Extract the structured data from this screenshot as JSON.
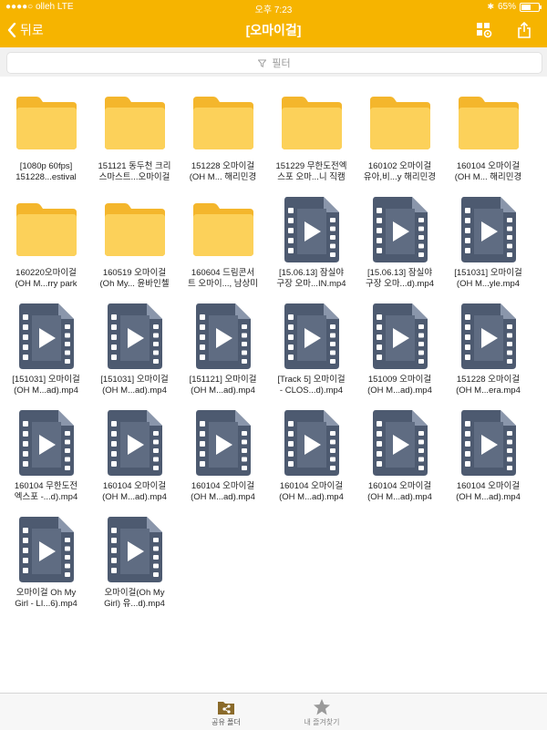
{
  "status_bar": {
    "carrier": "●●●●○ olleh  LTE",
    "time": "오후 7:23",
    "battery": "65%",
    "battery_level": 0.65
  },
  "nav": {
    "back_label": "뒤로",
    "title": "[오마이걸]"
  },
  "filter": {
    "placeholder": "필터"
  },
  "items": [
    {
      "type": "folder",
      "label": "[1080p 60fps]\n151228...estival"
    },
    {
      "type": "folder",
      "label": "151121 동두천 크리\n스마스트...오마이걸"
    },
    {
      "type": "folder",
      "label": "151228 오마이걸\n(OH M... 해리민경"
    },
    {
      "type": "folder",
      "label": "151229 무한도전엑\n스포 오마...니 직캠"
    },
    {
      "type": "folder",
      "label": "160102 오마이걸\n유아,비...y 해리민경"
    },
    {
      "type": "folder",
      "label": "160104 오마이걸\n(OH M... 해리민경"
    },
    {
      "type": "folder",
      "label": "160220오마이걸\n(OH M...rry park"
    },
    {
      "type": "folder",
      "label": "160519 오마이걸\n(Oh My... 윤바인첼"
    },
    {
      "type": "folder",
      "label": "160604 드림콘서\n트 오마이..., 남상미"
    },
    {
      "type": "video",
      "label": "[15.06.13] 잠실야\n구장 오마...IN.mp4"
    },
    {
      "type": "video",
      "label": "[15.06.13] 잠실야\n구장 오마...d).mp4"
    },
    {
      "type": "video",
      "label": "[151031] 오마이걸\n(OH M...yle.mp4"
    },
    {
      "type": "video",
      "label": "[151031] 오마이걸\n(OH M...ad).mp4"
    },
    {
      "type": "video",
      "label": "[151031] 오마이걸\n(OH M...ad).mp4"
    },
    {
      "type": "video",
      "label": "[151121] 오마이걸\n(OH M...ad).mp4"
    },
    {
      "type": "video",
      "label": "[Track 5] 오마이걸\n- CLOS...d).mp4"
    },
    {
      "type": "video",
      "label": "151009 오마이걸\n(OH M...ad).mp4"
    },
    {
      "type": "video",
      "label": "151228 오마이걸\n(OH M...era.mp4"
    },
    {
      "type": "video",
      "label": "160104 무한도전\n엑스포 -...d).mp4"
    },
    {
      "type": "video",
      "label": "160104 오마이걸\n(OH M...ad).mp4"
    },
    {
      "type": "video",
      "label": "160104 오마이걸\n(OH M...ad).mp4"
    },
    {
      "type": "video",
      "label": "160104 오마이걸\n(OH M...ad).mp4"
    },
    {
      "type": "video",
      "label": "160104 오마이걸\n(OH M...ad).mp4"
    },
    {
      "type": "video",
      "label": "160104 오마이걸\n(OH M...ad).mp4"
    },
    {
      "type": "video",
      "label": "오마이걸 Oh My\nGirl - LI...6).mp4"
    },
    {
      "type": "video",
      "label": "오마이걸(Oh My\nGirl) 유...d).mp4"
    }
  ],
  "tabs": [
    {
      "label": "공유 폴더",
      "icon": "shared-folder-icon",
      "active": true
    },
    {
      "label": "내 즐겨찾기",
      "icon": "star-icon",
      "active": false
    }
  ],
  "colors": {
    "accent": "#f6b400",
    "folder": "#f9c23c",
    "video": "#4d5a70"
  }
}
